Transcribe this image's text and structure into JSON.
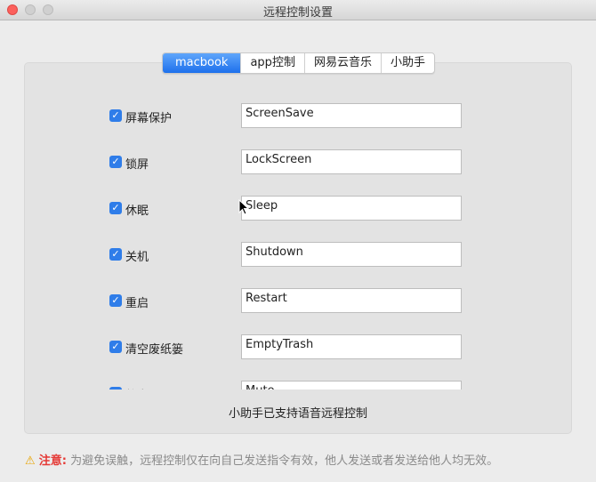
{
  "window": {
    "title": "远程控制设置"
  },
  "tabs": [
    {
      "label": "macbook"
    },
    {
      "label": "app控制"
    },
    {
      "label": "网易云音乐"
    },
    {
      "label": "小助手"
    }
  ],
  "rows": [
    {
      "label": "屏幕保护",
      "value": "ScreenSave",
      "checked": true
    },
    {
      "label": "锁屏",
      "value": "LockScreen",
      "checked": true
    },
    {
      "label": "休眠",
      "value": "Sleep",
      "checked": true
    },
    {
      "label": "关机",
      "value": "Shutdown",
      "checked": true
    },
    {
      "label": "重启",
      "value": "Restart",
      "checked": true
    },
    {
      "label": "清空废纸篓",
      "value": "EmptyTrash",
      "checked": true
    },
    {
      "label": "静音",
      "value": "Mute",
      "checked": true
    }
  ],
  "footer": {
    "note": "小助手已支持语音远程控制"
  },
  "warning": {
    "icon": "⚠",
    "label": "注意:",
    "text": "为避免误触，远程控制仅在向自己发送指令有效，他人发送或者发送给他人均无效。"
  },
  "colors": {
    "accent": "#2f7de9",
    "warning_label": "#e53935"
  }
}
